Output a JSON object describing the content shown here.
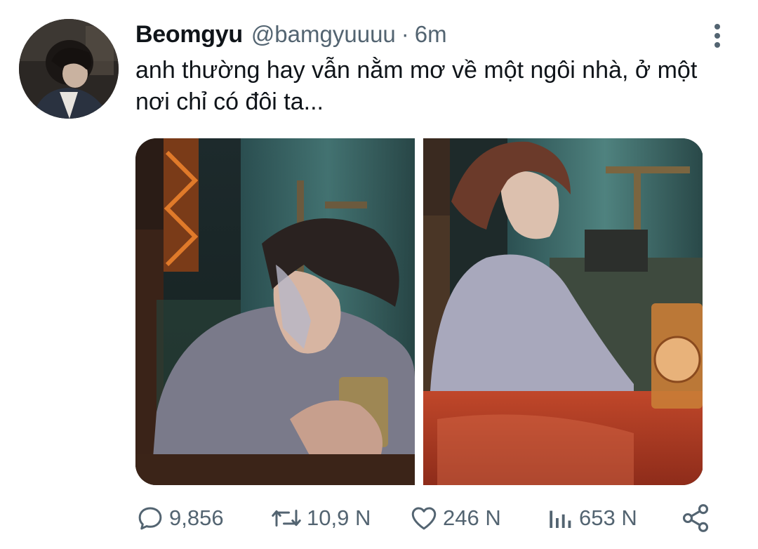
{
  "tweet": {
    "display_name": "Beomgyu",
    "handle": "@bamgyuuuu",
    "separator": "·",
    "time": "6m",
    "text": "anh thường hay vẫn nằm mơ về một ngôi nhà, ở một nơi chỉ có đôi ta..."
  },
  "actions": {
    "reply_count": "9,856",
    "retweet_count": "10,9 N",
    "like_count": "246 N",
    "views_count": "653 N"
  },
  "icons": {
    "more": "more-vertical-icon",
    "reply": "reply-icon",
    "retweet": "retweet-icon",
    "like": "heart-icon",
    "views": "views-icon",
    "share": "share-icon"
  },
  "colors": {
    "text": "#0f1419",
    "secondary": "#536471"
  }
}
